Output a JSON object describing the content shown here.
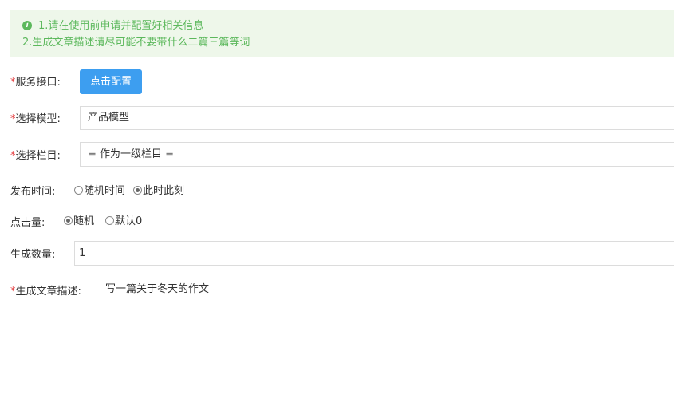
{
  "notice": {
    "line1": "1.请在使用前申请并配置好相关信息",
    "line2": "2.生成文章描述请尽可能不要带什么二篇三篇等词"
  },
  "form": {
    "service": {
      "required_mark": "*",
      "label": "服务接口:",
      "button_label": "点击配置"
    },
    "model": {
      "required_mark": "*",
      "label": "选择模型:",
      "value": "产品模型"
    },
    "column": {
      "required_mark": "*",
      "label": "选择栏目:",
      "value": "≡ 作为一级栏目 ≡"
    },
    "publish_time": {
      "label": "发布时间:",
      "options": [
        {
          "label": "随机时间",
          "checked": false
        },
        {
          "label": "此时此刻",
          "checked": true
        }
      ]
    },
    "clicks": {
      "label": "点击量:",
      "options": [
        {
          "label": "随机",
          "checked": true
        },
        {
          "label": "默认0",
          "checked": false
        }
      ]
    },
    "count": {
      "label": "生成数量:",
      "value": "1"
    },
    "description": {
      "required_mark": "*",
      "label": "生成文章描述:",
      "value": "写一篇关于冬天的作文"
    }
  }
}
